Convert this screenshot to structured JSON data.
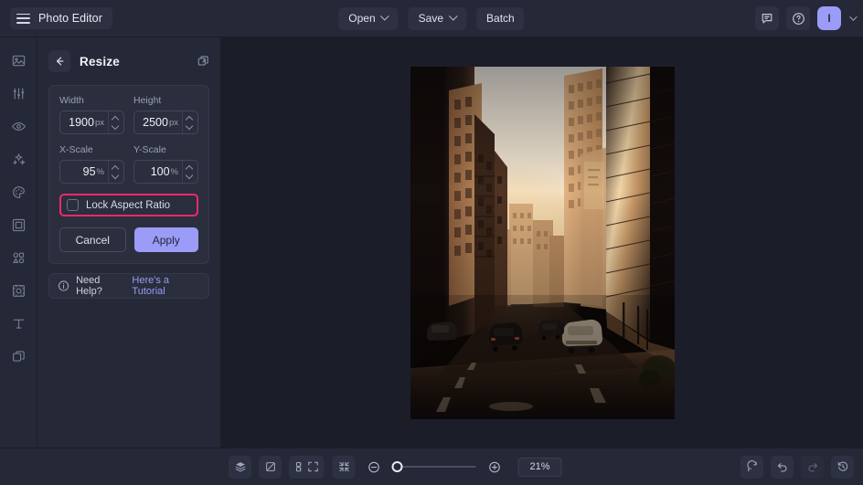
{
  "header": {
    "menu_icon": "hamburger-icon",
    "title": "Photo Editor",
    "open_label": "Open",
    "save_label": "Save",
    "batch_label": "Batch",
    "feedback_icon": "chat-icon",
    "help_icon": "question-circle-icon",
    "avatar_initial": "I"
  },
  "rail": {
    "items": [
      {
        "icon": "image-icon",
        "name": "sidebar-item-image"
      },
      {
        "icon": "sliders-icon",
        "name": "sidebar-item-adjust"
      },
      {
        "icon": "eye-icon",
        "name": "sidebar-item-retouch"
      },
      {
        "icon": "sparkles-icon",
        "name": "sidebar-item-effects"
      },
      {
        "icon": "palette-icon",
        "name": "sidebar-item-filters"
      },
      {
        "icon": "frame-icon",
        "name": "sidebar-item-crop"
      },
      {
        "icon": "shapes-icon",
        "name": "sidebar-item-shapes"
      },
      {
        "icon": "resize-icon",
        "name": "sidebar-item-resize"
      },
      {
        "icon": "text-icon",
        "name": "sidebar-item-text"
      },
      {
        "icon": "layers-icon",
        "name": "sidebar-item-layers"
      }
    ]
  },
  "panel": {
    "back_icon": "back-arrow-icon",
    "title": "Resize",
    "duplicate_icon": "duplicate-icon",
    "width": {
      "label": "Width",
      "value": "1900",
      "unit": "px"
    },
    "height": {
      "label": "Height",
      "value": "2500",
      "unit": "px"
    },
    "x_scale": {
      "label": "X-Scale",
      "value": "95",
      "unit": "%"
    },
    "y_scale": {
      "label": "Y-Scale",
      "value": "100",
      "unit": "%"
    },
    "lock_aspect": {
      "label": "Lock Aspect Ratio",
      "checked": false,
      "highlight_color": "#ee2a6c"
    },
    "cancel_label": "Cancel",
    "apply_label": "Apply",
    "help": {
      "icon": "info-icon",
      "text": "Need Help?",
      "link": "Here's a Tutorial"
    }
  },
  "canvas": {
    "image_description": "golden hour city street canyon with sunlit buildings and cars"
  },
  "bottombar": {
    "left_tools": [
      {
        "icon": "layers-stack-icon",
        "name": "layers-panel-button"
      },
      {
        "icon": "transparency-icon",
        "name": "transparency-button"
      },
      {
        "icon": "grid-icon",
        "name": "grid-button"
      }
    ],
    "fit_screen_icon": "fit-screen-icon",
    "fit_contract_icon": "fit-contract-icon",
    "zoom_out_icon": "zoom-out-icon",
    "zoom_in_icon": "zoom-in-icon",
    "zoom_value": "21%",
    "slider_position_pct": 0,
    "right_tools": [
      {
        "icon": "reset-icon",
        "name": "reset-button",
        "disabled": false
      },
      {
        "icon": "undo-icon",
        "name": "undo-button",
        "disabled": false
      },
      {
        "icon": "redo-icon",
        "name": "redo-button",
        "disabled": true
      },
      {
        "icon": "history-icon",
        "name": "history-button",
        "disabled": false
      }
    ]
  },
  "colors": {
    "background": "#1b1d29",
    "surface": "#252836",
    "card": "#2b2e3d",
    "accent": "#9a9cf7",
    "highlight": "#ee2a6c"
  }
}
